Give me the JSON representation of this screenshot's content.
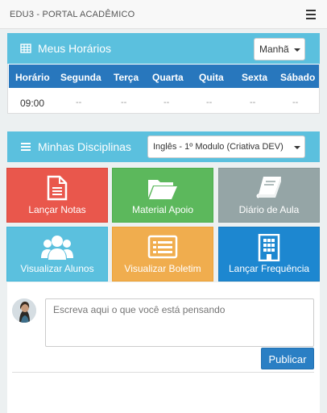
{
  "app": {
    "title": "EDU3 - PORTAL ACADÊMICO"
  },
  "schedule": {
    "title": "Meus Horários",
    "shift": "Manhã",
    "columns": [
      "Horário",
      "Segunda",
      "Terça",
      "Quarta",
      "Quita",
      "Sexta",
      "Sábado"
    ],
    "rows": [
      [
        "09:00",
        "--",
        "--",
        "--",
        "--",
        "--",
        "--"
      ]
    ]
  },
  "subjects": {
    "title": "Minhas Disciplinas",
    "selected": "Inglês - 1º Modulo (Criativa DEV)"
  },
  "tiles": [
    {
      "label": "Lançar Notas",
      "icon": "document-icon",
      "color": "#e9574c"
    },
    {
      "label": "Material Apoio",
      "icon": "folder-open-icon",
      "color": "#5cb85c"
    },
    {
      "label": "Diário de Aula",
      "icon": "book-icon",
      "color": "#95a5a6"
    },
    {
      "label": "Visualizar Alunos",
      "icon": "users-icon",
      "color": "#5bc0de"
    },
    {
      "label": "Visualizar Boletim",
      "icon": "list-card-icon",
      "color": "#f0ad4e"
    },
    {
      "label": "Lançar Frequência",
      "icon": "building-icon",
      "color": "#1d87d0"
    }
  ],
  "post": {
    "placeholder": "Escreva aqui o que você está pensando",
    "publish_label": "Publicar"
  }
}
